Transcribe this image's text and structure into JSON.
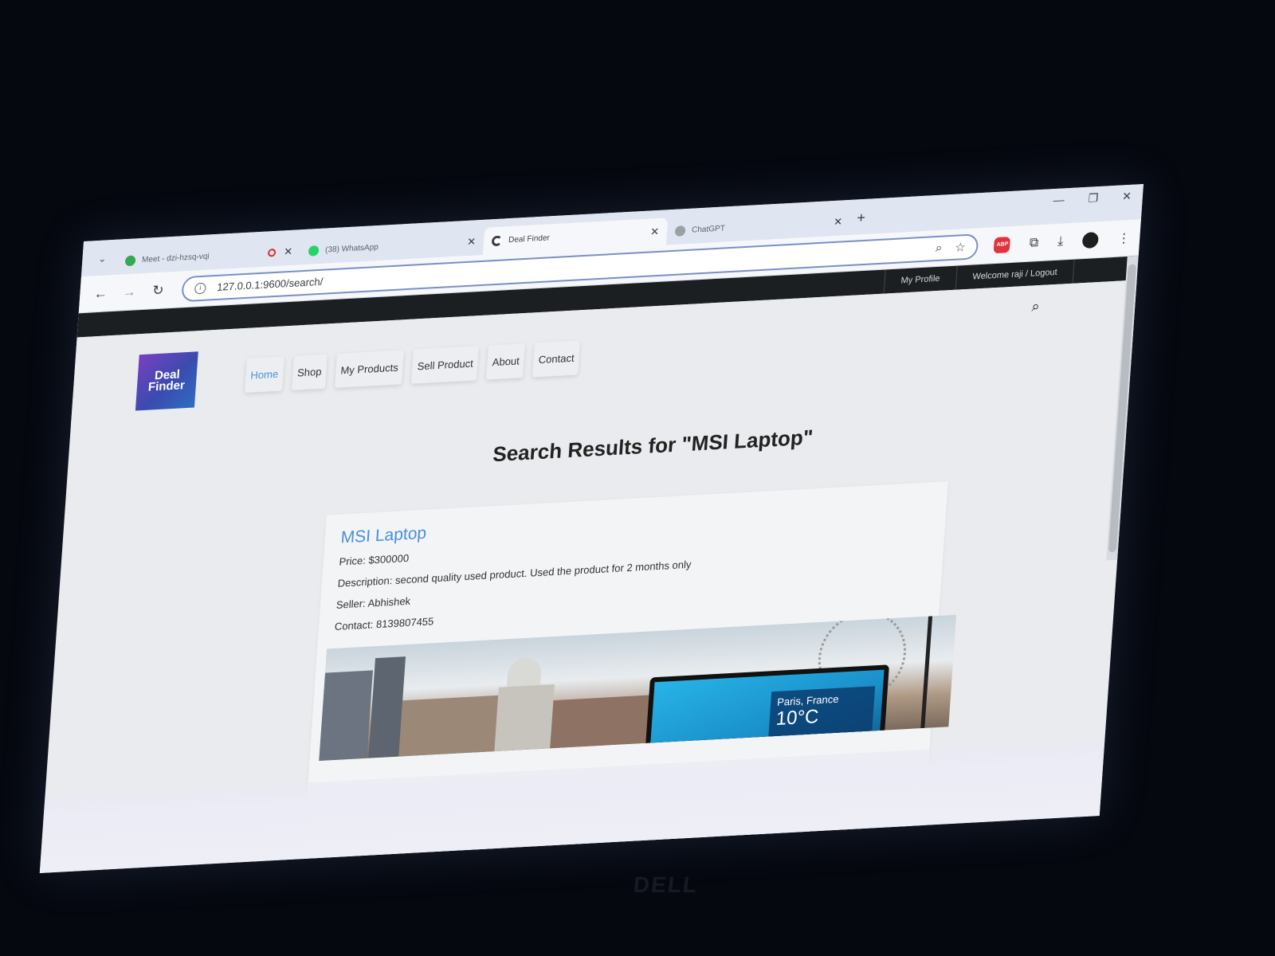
{
  "browser": {
    "tabs": [
      {
        "title": "Meet - dzi-hzsq-vqi",
        "favicon_color": "#34a853",
        "recording": true,
        "active": false
      },
      {
        "title": "(38) WhatsApp",
        "favicon_color": "#25d366",
        "recording": false,
        "active": false
      },
      {
        "title": "Deal Finder",
        "favicon_color": "#3c4043",
        "recording": false,
        "active": true
      },
      {
        "title": "ChatGPT",
        "favicon_color": "#9aa0a6",
        "recording": false,
        "active": false
      }
    ],
    "new_tab": "+",
    "window_controls": [
      "—",
      "❐",
      "✕"
    ],
    "url": "127.0.0.1:9600/search/",
    "abp_label": "ABP",
    "icons": [
      "back-icon",
      "forward-icon",
      "reload-icon",
      "zoom-icon",
      "star-icon",
      "extensions-icon",
      "download-icon",
      "menu-icon"
    ]
  },
  "site": {
    "topbar": {
      "my_profile": "My Profile",
      "welcome": "Welcome raji / Logout"
    },
    "logo_line1": "Deal",
    "logo_line2": "Finder",
    "nav": [
      {
        "label": "Home",
        "active": true
      },
      {
        "label": "Shop",
        "active": false
      },
      {
        "label": "My Products",
        "active": false
      },
      {
        "label": "Sell Product",
        "active": false
      },
      {
        "label": "About",
        "active": false
      },
      {
        "label": "Contact",
        "active": false
      }
    ],
    "accent_color": "#4a90d9",
    "results_title": "Search Results for \"MSI Laptop\"",
    "product": {
      "title": "MSI Laptop",
      "price": "Price: $300000",
      "description": "Description: second quality used product. Used the product for 2 months only",
      "seller": "Seller: Abhishek",
      "contact": "Contact: 8139807455",
      "image_overlay_city": "Paris, France",
      "image_overlay_temp": "10°C"
    }
  },
  "monitor_brand": "DELL"
}
